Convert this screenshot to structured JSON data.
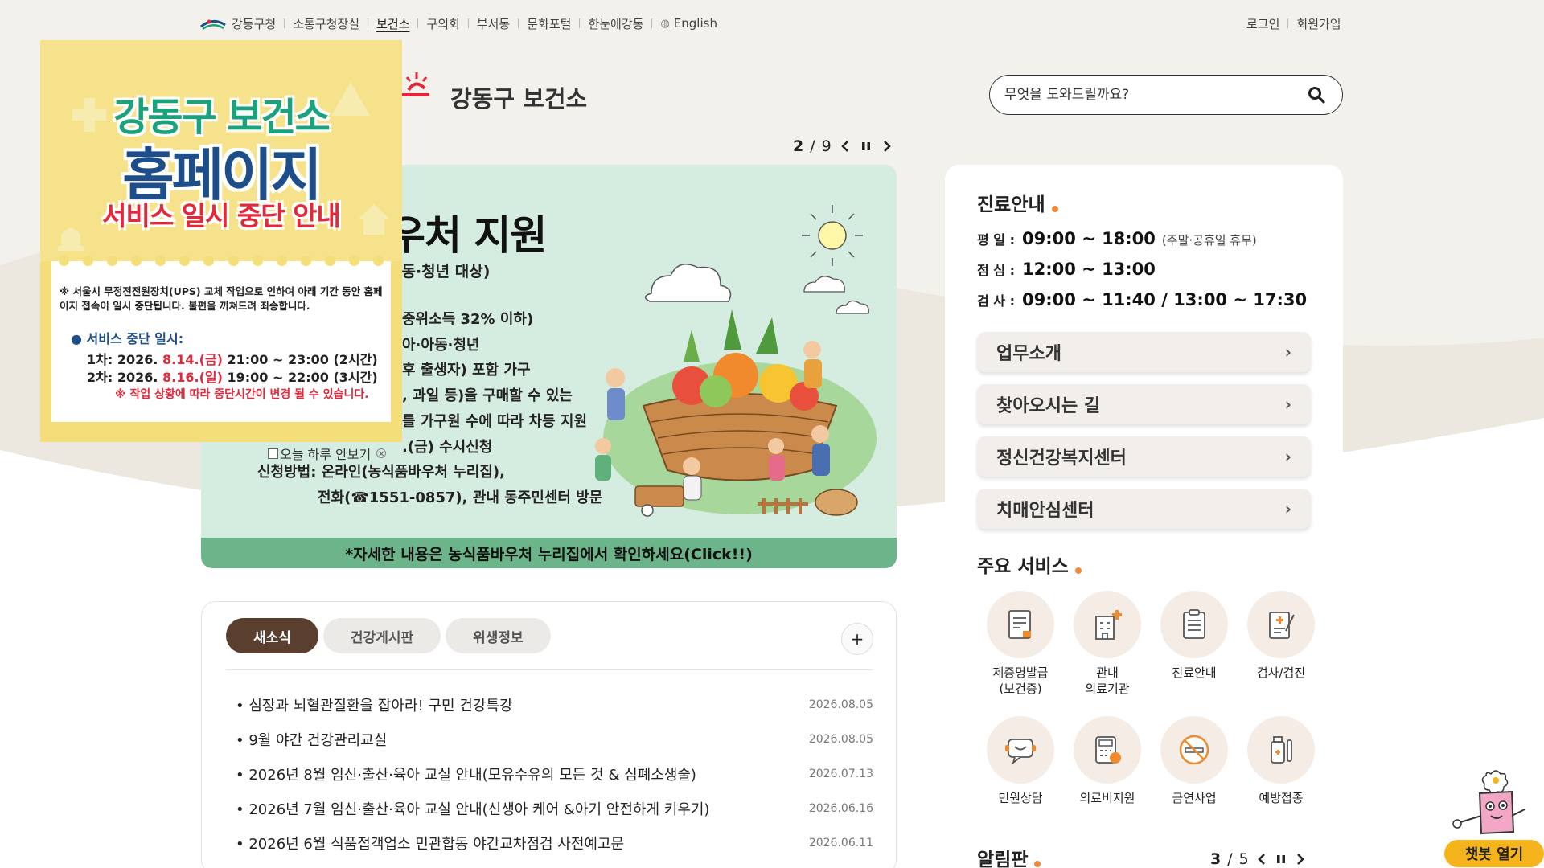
{
  "topnav": {
    "items": [
      {
        "label": "강동구청",
        "active": false
      },
      {
        "label": "소통구청장실",
        "active": false
      },
      {
        "label": "보건소",
        "active": true
      },
      {
        "label": "구의회",
        "active": false
      },
      {
        "label": "부서동",
        "active": false
      },
      {
        "label": "문화포털",
        "active": false
      },
      {
        "label": "한눈에강동",
        "active": false
      },
      {
        "label": "English",
        "active": false
      }
    ],
    "login": "로그인",
    "signup": "회원가입"
  },
  "header": {
    "site_title": "강동구 보건소",
    "search_placeholder": "무엇을 도와드릴까요?"
  },
  "slider": {
    "current": "2",
    "separator": "/",
    "total": "9"
  },
  "banner": {
    "headline": "우처 지원",
    "subhead": "아동·청년 대상)",
    "lines": [
      "중위소득 32% 이하)",
      "아·아동·청년",
      "후 출생자) 포함 가구",
      ", 과일 등)을 구매할 수 있는",
      "를 가구원 수에 따라 차등 지원",
      ".(금) 수시신청",
      "신청방법: 온라인(농식품바우처 누리집),",
      "전화(☎1551-0857), 관내 동주민센터 방문"
    ],
    "footer": "*자세한 내용은 농식품바우처 누리집에서 확인하세요(Click!!)"
  },
  "popup": {
    "title1": "강동구 보건소",
    "title2": "홈페이지",
    "title3": "서비스 일시 중단 안내",
    "notice": "※ 서울시 무정전전원장치(UPS) 교체 작업으로 인하여 아래 기간 동안 홈페이지 접속이 일시 중단됩니다. 불편을 끼쳐드려 죄송합니다.",
    "svc_title": "● 서비스 중단 일시:",
    "slot1_prefix": "1차: 2026.",
    "slot1_date": "8.14.(금)",
    "slot1_time": "21:00 ~ 23:00 (2시간)",
    "slot2_prefix": "2차: 2026.",
    "slot2_date": "8.16.(일)",
    "slot2_time": "19:00 ~ 22:00 (3시간)",
    "caution": "※ 작업 상황에 따라 중단시간이 변경 될 수 있습니다.",
    "dismiss_label": "오늘 하루 안보기"
  },
  "news": {
    "tabs": [
      {
        "label": "새소식",
        "active": true
      },
      {
        "label": "건강게시판",
        "active": false
      },
      {
        "label": "위생정보",
        "active": false
      }
    ],
    "more": "+",
    "items": [
      {
        "title": "심장과 뇌혈관질환을 잡아라! 구민 건강특강",
        "date": "2026.08.05"
      },
      {
        "title": "9월 야간 건강관리교실",
        "date": "2026.08.05"
      },
      {
        "title": "2026년 8월 임신·출산·육아 교실 안내(모유수유의 모든 것 & 심폐소생술)",
        "date": "2026.07.13"
      },
      {
        "title": "2026년 7월 임신·출산·육아 교실 안내(신생아 케어 &아기 안전하게 키우기)",
        "date": "2026.06.16"
      },
      {
        "title": "2026년 6월 식품접객업소 민관합동 야간교차점검 사전예고문",
        "date": "2026.06.11"
      }
    ]
  },
  "panel": {
    "hours_title": "진료안내",
    "hours": [
      {
        "label": "평 일 :",
        "value": "09:00 ~ 18:00",
        "note": "(주말·공휴일 휴무)"
      },
      {
        "label": "점 심 :",
        "value": "12:00 ~ 13:00",
        "note": ""
      },
      {
        "label": "검 사 :",
        "value": "09:00 ~ 11:40 / 13:00 ~ 17:30",
        "note": ""
      }
    ],
    "links": [
      {
        "label": "업무소개"
      },
      {
        "label": "찾아오시는 길"
      },
      {
        "label": "정신건강복지센터"
      },
      {
        "label": "치매안심센터"
      }
    ],
    "services_title": "주요 서비스",
    "services": [
      {
        "label": "제증명발급\n(보건증)",
        "icon": "certificate-icon"
      },
      {
        "label": "관내\n의료기관",
        "icon": "hospital-icon"
      },
      {
        "label": "진료안내",
        "icon": "clipboard-icon"
      },
      {
        "label": "검사/검진",
        "icon": "checkup-icon"
      },
      {
        "label": "민원상담",
        "icon": "consult-icon"
      },
      {
        "label": "의료비지원",
        "icon": "calculator-icon"
      },
      {
        "label": "금연사업",
        "icon": "no-smoking-icon"
      },
      {
        "label": "예방접종",
        "icon": "vaccine-icon"
      }
    ],
    "notice_title": "알림판",
    "notice_current": "3",
    "notice_separator": "/",
    "notice_total": "5"
  },
  "chatbot": {
    "label": "챗봇 열기"
  },
  "colors": {
    "accent_orange": "#ef8a3c",
    "tab_active": "#5a3f2e",
    "banner_bg": "#d5ede0",
    "banner_footer": "#6cb48a",
    "chatbot": "#f6b41c"
  }
}
